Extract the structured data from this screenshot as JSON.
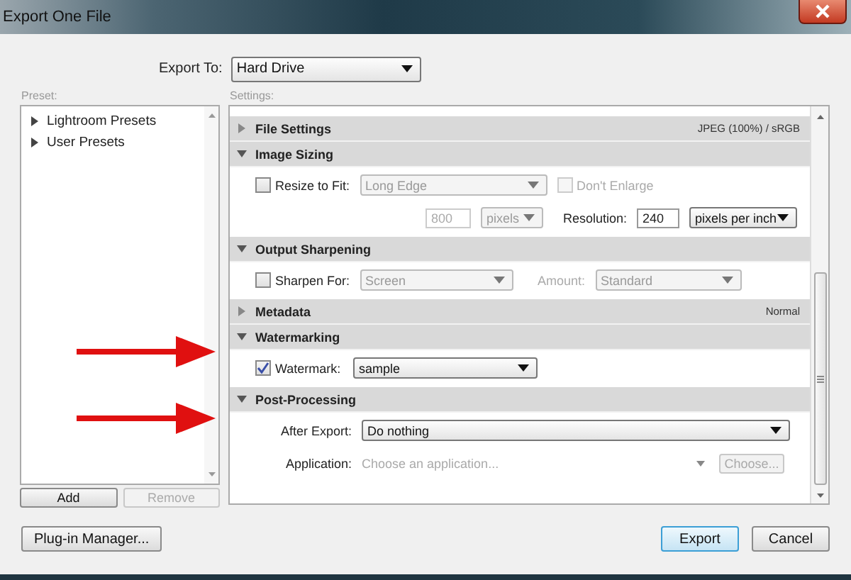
{
  "window": {
    "title": "Export One File"
  },
  "export_to": {
    "label": "Export To:",
    "value": "Hard Drive"
  },
  "preset": {
    "label": "Preset:",
    "items": [
      {
        "label": "Lightroom Presets",
        "expanded": false
      },
      {
        "label": "User Presets",
        "expanded": false
      }
    ],
    "buttons": [
      {
        "label": "Add",
        "disabled": false
      },
      {
        "label": "Remove",
        "disabled": true
      }
    ]
  },
  "settings": {
    "label": "Settings:",
    "sections": [
      {
        "title": "File Settings",
        "expanded": false,
        "summary": "JPEG (100%) / sRGB"
      },
      {
        "title": "Image Sizing",
        "expanded": true,
        "rows": [
          {
            "items": [
              {
                "kind": "checkbox",
                "label": "Resize to Fit:",
                "checked": false,
                "disabled": false
              },
              {
                "kind": "dropdown",
                "value": "Long Edge",
                "disabled": true
              },
              {
                "kind": "checkbox",
                "label": "Don't Enlarge",
                "checked": false,
                "disabled": true
              }
            ]
          },
          {
            "items": [
              {
                "kind": "field",
                "value": "800",
                "disabled": true
              },
              {
                "kind": "dropdown",
                "value": "pixels",
                "disabled": true
              },
              {
                "kind": "label",
                "text": "Resolution:",
                "disabled": false
              },
              {
                "kind": "field",
                "value": "240",
                "disabled": false
              },
              {
                "kind": "dropdown",
                "value": "pixels per inch",
                "disabled": false
              }
            ]
          }
        ]
      },
      {
        "title": "Output Sharpening",
        "expanded": true,
        "rows": [
          {
            "items": [
              {
                "kind": "checkbox",
                "label": "Sharpen For:",
                "checked": false,
                "disabled": false
              },
              {
                "kind": "dropdown",
                "value": "Screen",
                "disabled": true
              },
              {
                "kind": "label",
                "text": "Amount:",
                "disabled": true
              },
              {
                "kind": "dropdown",
                "value": "Standard",
                "disabled": true
              }
            ]
          }
        ]
      },
      {
        "title": "Metadata",
        "expanded": false,
        "summary": "Normal"
      },
      {
        "title": "Watermarking",
        "expanded": true,
        "rows": [
          {
            "items": [
              {
                "kind": "checkbox",
                "label": "Watermark:",
                "checked": true,
                "disabled": false
              },
              {
                "kind": "dropdown",
                "value": "sample",
                "disabled": false
              }
            ]
          }
        ]
      },
      {
        "title": "Post-Processing",
        "expanded": true,
        "rows": [
          {
            "items": [
              {
                "kind": "label",
                "text": "After Export:",
                "disabled": false
              },
              {
                "kind": "dropdown",
                "value": "Do nothing",
                "disabled": false
              }
            ]
          },
          {
            "items": [
              {
                "kind": "label",
                "text": "Application:",
                "disabled": false
              },
              {
                "kind": "combo",
                "placeholder": "Choose an application...",
                "disabled": true
              },
              {
                "kind": "button",
                "label": "Choose...",
                "disabled": true
              }
            ]
          }
        ]
      }
    ]
  },
  "buttons": [
    {
      "label": "Plug-in Manager...",
      "kind": "secondary"
    },
    {
      "label": "Export",
      "kind": "default"
    },
    {
      "label": "Cancel",
      "kind": "secondary"
    }
  ]
}
